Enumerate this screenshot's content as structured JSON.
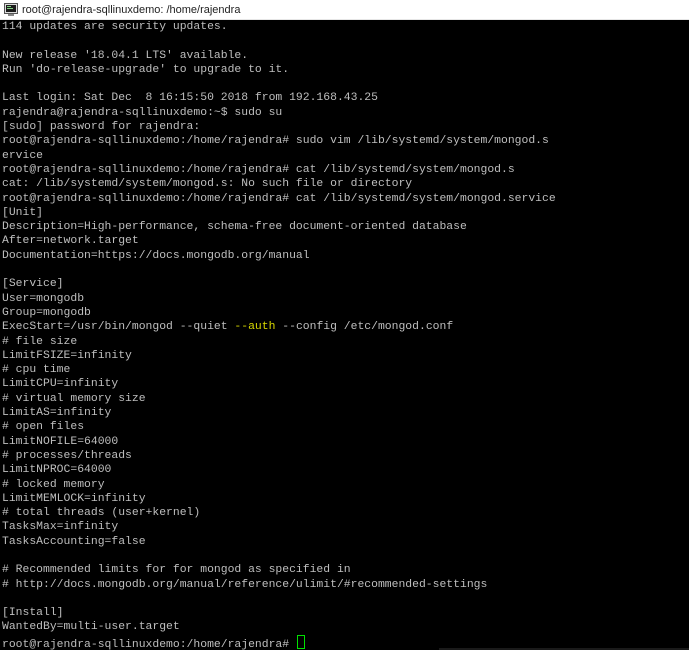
{
  "window": {
    "title": "root@rajendra-sqllinuxdemo: /home/rajendra"
  },
  "colors": {
    "background": "#000000",
    "text": "#bfbfbf",
    "highlight": "#d8d800",
    "cursor": "#00e000"
  },
  "icons": {
    "app": "putty-terminal-icon"
  },
  "terminal": {
    "lines": [
      "114 updates are security updates.",
      "",
      "New release '18.04.1 LTS' available.",
      "Run 'do-release-upgrade' to upgrade to it.",
      "",
      "Last login: Sat Dec  8 16:15:50 2018 from 192.168.43.25",
      "rajendra@rajendra-sqllinuxdemo:~$ sudo su",
      "[sudo] password for rajendra:",
      "root@rajendra-sqllinuxdemo:/home/rajendra# sudo vim /lib/systemd/system/mongod.s",
      "ervice",
      "root@rajendra-sqllinuxdemo:/home/rajendra# cat /lib/systemd/system/mongod.s",
      "cat: /lib/systemd/system/mongod.s: No such file or directory",
      "root@rajendra-sqllinuxdemo:/home/rajendra# cat /lib/systemd/system/mongod.service",
      "[Unit]",
      "Description=High-performance, schema-free document-oriented database",
      "After=network.target",
      "Documentation=https://docs.mongodb.org/manual",
      "",
      "[Service]",
      "User=mongodb",
      "Group=mongodb",
      "ExecStart=/usr/bin/mongod --quiet --auth --config /etc/mongod.conf",
      "# file size",
      "LimitFSIZE=infinity",
      "# cpu time",
      "LimitCPU=infinity",
      "# virtual memory size",
      "LimitAS=infinity",
      "# open files",
      "LimitNOFILE=64000",
      "# processes/threads",
      "LimitNPROC=64000",
      "# locked memory",
      "LimitMEMLOCK=infinity",
      "# total threads (user+kernel)",
      "TasksMax=infinity",
      "TasksAccounting=false",
      "",
      "# Recommended limits for for mongod as specified in",
      "# http://docs.mongodb.org/manual/reference/ulimit/#recommended-settings",
      "",
      "[Install]",
      "WantedBy=multi-user.target",
      "root@rajendra-sqllinuxdemo:/home/rajendra# "
    ],
    "highlighted_token": "--auth"
  }
}
